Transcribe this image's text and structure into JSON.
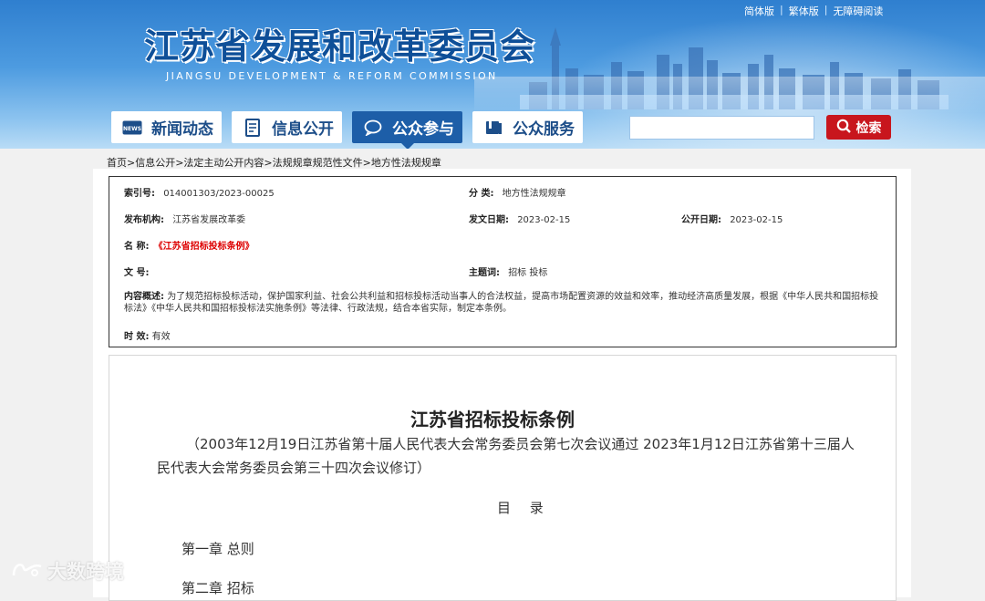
{
  "header": {
    "title": "江苏省发展和改革委员会",
    "subtitle": "JIANGSU DEVELOPMENT & REFORM COMMISSION",
    "top_links": [
      "简体版",
      "繁体版",
      "无障碍阅读"
    ]
  },
  "nav": [
    {
      "label": "新闻动态",
      "icon": "news-icon"
    },
    {
      "label": "信息公开",
      "icon": "document-icon"
    },
    {
      "label": "公众参与",
      "icon": "chat-bubble-icon",
      "active": true
    },
    {
      "label": "公众服务",
      "icon": "book-icon"
    }
  ],
  "search": {
    "value": "",
    "button_label": "检索",
    "icon": "search-icon"
  },
  "breadcrumb": "首页>信息公开>法定主动公开内容>法规规章规范性文件>地方性法规规章",
  "info": {
    "index_label": "索引号:",
    "index_value": "014001303/2023-00025",
    "category_label": "分  类:",
    "category_value": "地方性法规规章",
    "publisher_label": "发布机构:",
    "publisher_value": "江苏省发展改革委",
    "issue_date_label": "发文日期:",
    "issue_date_value": "2023-02-15",
    "public_date_label": "公开日期:",
    "public_date_value": "2023-02-15",
    "name_label": "名  称:",
    "name_value": "《江苏省招标投标条例》",
    "docno_label": "文  号:",
    "docno_value": "",
    "keyword_label": "主题词:",
    "keyword_value": "招标 投标",
    "summary_label": "内容概述:",
    "summary_value": "为了规范招标投标活动，保护国家利益、社会公共利益和招标投标活动当事人的合法权益，提高市场配置资源的效益和效率，推动经济高质量发展，根据《中华人民共和国招标投标法》《中华人民共和国招标投标法实施条例》等法律、行政法规，结合本省实际，制定本条例。",
    "validity_label": "时  效:",
    "validity_value": "有效"
  },
  "doc": {
    "title": "江苏省招标投标条例",
    "note": "（2003年12月19日江苏省第十届人民代表大会常务委员会第七次会议通过  2023年1月12日江苏省第十三届人民代表大会常务委员会第三十四次会议修订）",
    "toc": "目 录",
    "chapters": [
      "第一章  总则",
      "第二章  招标"
    ]
  },
  "watermark": "大数跨境"
}
